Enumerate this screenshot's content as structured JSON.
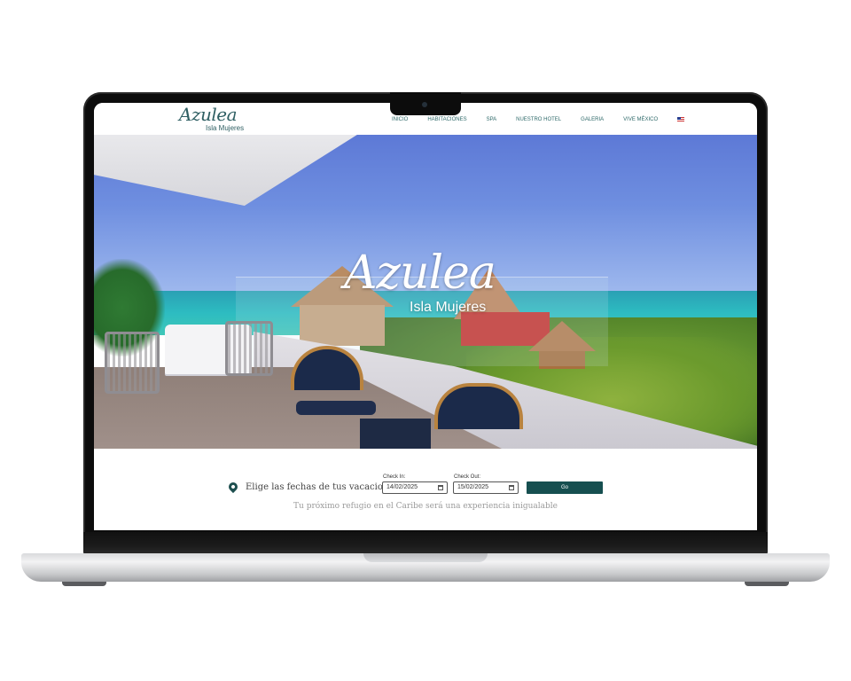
{
  "header": {
    "logo_script": "Azulea",
    "logo_sub": "Isla Mujeres",
    "nav": [
      "INICIO",
      "HABITACIONES",
      "SPA",
      "NUESTRO HOTEL",
      "GALERIA",
      "VIVE MÉXICO"
    ],
    "language_icon": "us-flag-icon"
  },
  "hero": {
    "logo_script": "Azulea",
    "logo_sub": "Isla Mujeres"
  },
  "booking": {
    "prompt": "Elige las fechas de tus vacaciones",
    "check_in_label": "Check In:",
    "check_in_value": "14/02/2025",
    "check_out_label": "Check Out:",
    "check_out_value": "15/02/2025",
    "go_label": "Go",
    "tagline": "Tu próximo refugio en el Caribe será una experiencia inigualable"
  },
  "colors": {
    "brand": "#164f50",
    "nav_text": "#2f6a6a"
  }
}
